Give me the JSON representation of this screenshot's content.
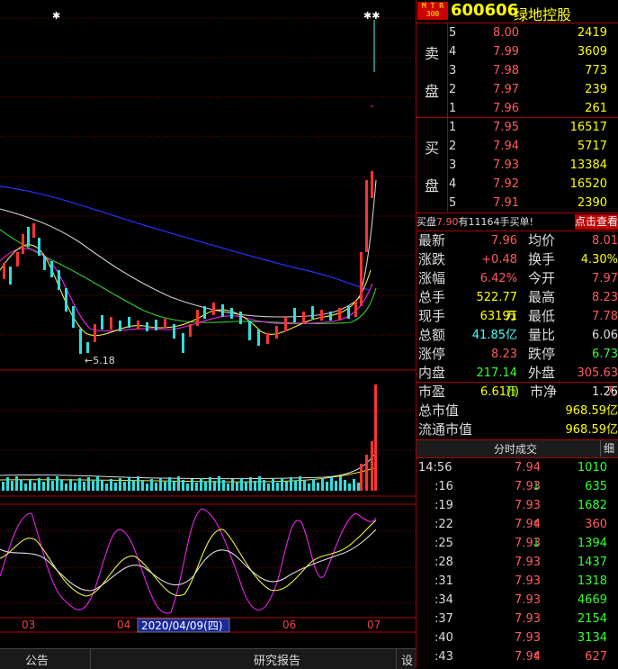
{
  "stock": {
    "logo_lines": [
      "M T R",
      "300"
    ],
    "code": "600606",
    "name": "绿地控股"
  },
  "sell_label": [
    "卖",
    "盘"
  ],
  "buy_label": [
    "买",
    "盘"
  ],
  "sell_orders": [
    {
      "idx": "5",
      "price": "8.00",
      "vol": "2419"
    },
    {
      "idx": "4",
      "price": "7.99",
      "vol": "3609"
    },
    {
      "idx": "3",
      "price": "7.98",
      "vol": "773"
    },
    {
      "idx": "2",
      "price": "7.97",
      "vol": "239"
    },
    {
      "idx": "1",
      "price": "7.96",
      "vol": "261"
    }
  ],
  "buy_orders": [
    {
      "idx": "1",
      "price": "7.95",
      "vol": "16517"
    },
    {
      "idx": "2",
      "price": "7.94",
      "vol": "5717"
    },
    {
      "idx": "3",
      "price": "7.93",
      "vol": "13384"
    },
    {
      "idx": "4",
      "price": "7.92",
      "vol": "16520"
    },
    {
      "idx": "5",
      "price": "7.91",
      "vol": "2390"
    }
  ],
  "notice": {
    "prefix": "买盘",
    "price": "7.90",
    "mid": "有",
    "vol": "11164",
    "suffix": "手买单!",
    "button": "点击查看"
  },
  "quote_rows": [
    {
      "l1": "最新",
      "v1": "7.96",
      "c1": "red",
      "l2": "均价",
      "v2": "8.01",
      "c2": "red"
    },
    {
      "l1": "涨跌",
      "v1": "+0.48",
      "c1": "red",
      "l2": "换手",
      "v2": "4.30%",
      "c2": "yel"
    },
    {
      "l1": "涨幅",
      "v1": "6.42%",
      "c1": "red",
      "l2": "今开",
      "v2": "7.97",
      "c2": "red"
    },
    {
      "l1": "总手",
      "v1": "522.77万",
      "c1": "yel",
      "l2": "最高",
      "v2": "8.23",
      "c2": "red"
    },
    {
      "l1": "现手",
      "v1": "63191",
      "c1": "yel",
      "l2": "最低",
      "v2": "7.78",
      "c2": "red"
    },
    {
      "l1": "总额",
      "v1": "41.85亿",
      "c1": "cyan",
      "l2": "量比",
      "v2": "6.06",
      "c2": "wht"
    },
    {
      "l1": "涨停",
      "v1": "8.23",
      "c1": "red",
      "l2": "跌停",
      "v2": "6.73",
      "c2": "grn"
    },
    {
      "l1": "内盘",
      "v1": "217.14万",
      "c1": "grn",
      "l2": "外盘",
      "v2": "305.63万",
      "c2": "red"
    }
  ],
  "valuation": {
    "pe_label": "市盈",
    "pe": "6.61",
    "pe_badge": "(I)",
    "pb_label": "市净",
    "pb": "1.26",
    "mcap_label": "总市值",
    "mcap": "968.59亿",
    "float_label": "流通市值",
    "float": "968.59亿"
  },
  "ticks_header": {
    "title": "分时成交",
    "detail": "细"
  },
  "ticks": [
    {
      "time": "14:56",
      "price": "7.94",
      "arrow": "",
      "vol": "1010",
      "pc": "red",
      "vc": "grn"
    },
    {
      "time": ":16",
      "price": "7.93",
      "arrow": "↓",
      "vol": "635",
      "pc": "red",
      "vc": "grn"
    },
    {
      "time": ":19",
      "price": "7.93",
      "arrow": "",
      "vol": "1682",
      "pc": "red",
      "vc": "grn"
    },
    {
      "time": ":22",
      "price": "7.94",
      "arrow": "↑",
      "vol": "360",
      "pc": "red",
      "vc": "red"
    },
    {
      "time": ":25",
      "price": "7.93",
      "arrow": "↓",
      "vol": "1394",
      "pc": "red",
      "vc": "grn"
    },
    {
      "time": ":28",
      "price": "7.93",
      "arrow": "",
      "vol": "1437",
      "pc": "red",
      "vc": "grn"
    },
    {
      "time": ":31",
      "price": "7.93",
      "arrow": "",
      "vol": "1318",
      "pc": "red",
      "vc": "grn"
    },
    {
      "time": ":34",
      "price": "7.93",
      "arrow": "",
      "vol": "4669",
      "pc": "red",
      "vc": "grn"
    },
    {
      "time": ":37",
      "price": "7.93",
      "arrow": "",
      "vol": "2154",
      "pc": "red",
      "vc": "grn"
    },
    {
      "time": ":40",
      "price": "7.93",
      "arrow": "",
      "vol": "3134",
      "pc": "red",
      "vc": "grn"
    },
    {
      "time": ":43",
      "price": "7.94",
      "arrow": "↑",
      "vol": "627",
      "pc": "red",
      "vc": "red"
    }
  ],
  "chart": {
    "low_label": "5.18",
    "month_labels": [
      "03",
      "04",
      "06",
      "07"
    ],
    "cursor_date": "2020/04/09(四)"
  },
  "bottom": {
    "tab1": "公告",
    "tab2": "研究报告",
    "settings": "设"
  }
}
